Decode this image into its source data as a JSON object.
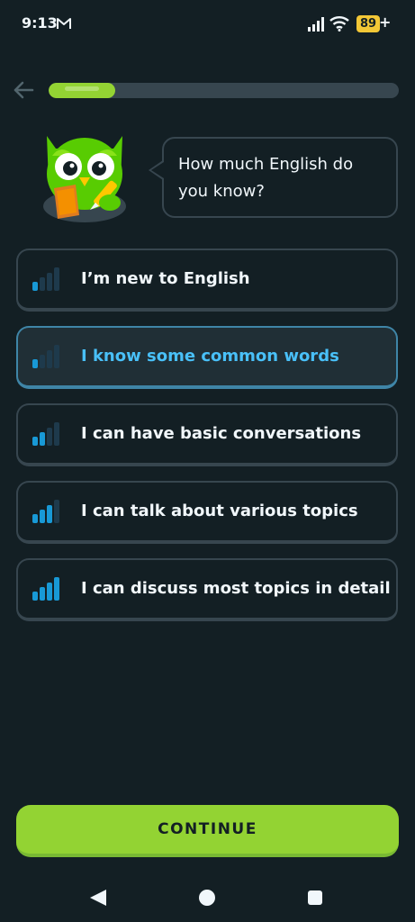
{
  "status_bar": {
    "time": "9:13",
    "battery": "89",
    "battery_charging": "+"
  },
  "progress": {
    "fraction": 0.19
  },
  "question": "How much English do you know?",
  "options": [
    {
      "label": "I’m new to English",
      "level": 1,
      "selected": false
    },
    {
      "label": "I know some common words",
      "level": 1,
      "selected": true
    },
    {
      "label": "I can have basic conversations",
      "level": 2,
      "selected": false
    },
    {
      "label": "I can talk about various topics",
      "level": 3,
      "selected": false
    },
    {
      "label": "I can discuss most topics in detail",
      "level": 4,
      "selected": false
    }
  ],
  "continue_label": "CONTINUE",
  "colors": {
    "background": "#131f24",
    "accent_green": "#93d333",
    "selected_blue": "#49c0f8",
    "bar_on": "#1899d6",
    "bar_off": "#1e3a4c",
    "border": "#37464f"
  },
  "icons": [
    "gmail-icon",
    "signal-icon",
    "wifi-icon",
    "back-arrow-icon",
    "owl-mascot",
    "nav-back-icon",
    "nav-home-icon",
    "nav-recents-icon"
  ]
}
